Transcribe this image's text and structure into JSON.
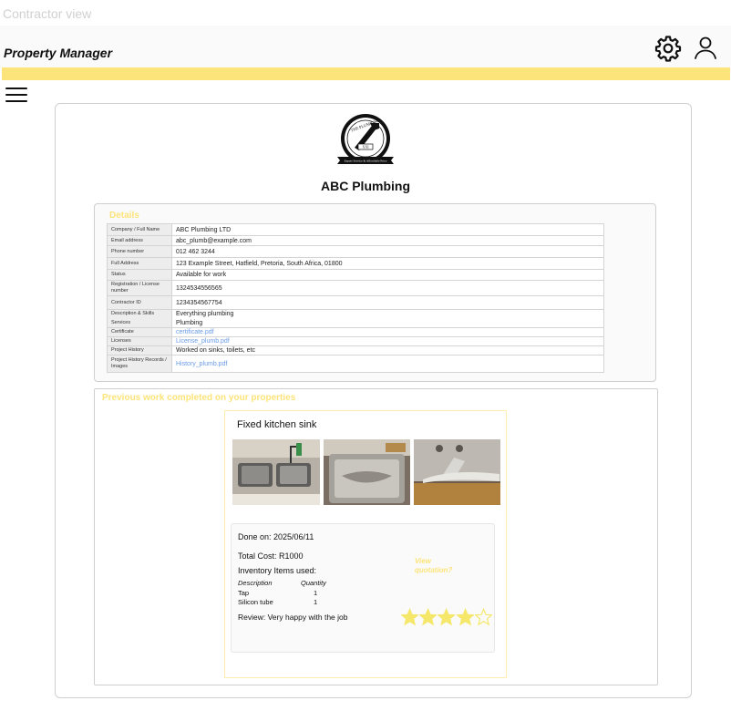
{
  "page_label": "Contractor view",
  "header": {
    "app_title": "Property Manager",
    "brand_color": "#fde47a",
    "icons": [
      "gear-icon",
      "user-icon"
    ]
  },
  "nav": {
    "menu_icon": "hamburger-icon"
  },
  "company": {
    "name": "ABC Plumbing",
    "logo": {
      "top_text": "THE PLUMBING",
      "badge_text": "XXI",
      "ribbon_text": "Expert Service & Affordable Price"
    }
  },
  "details": {
    "title": "Details",
    "rows": [
      {
        "label": "Company / Full Name",
        "value": "ABC Plumbing LTD"
      },
      {
        "label": "Email address",
        "value": "abc_plumb@example.com"
      },
      {
        "label": "Phone number",
        "value": "012 462 3244"
      },
      {
        "label": "Full Address",
        "value": "123 Example Street, Hatfield, Pretoria, South Africa, 01800"
      },
      {
        "label": "Status",
        "value": "Available for work"
      },
      {
        "label": "Registration / License number",
        "value": "1324534556565"
      },
      {
        "label": "Contractor ID",
        "value": "1234354567754"
      },
      {
        "label": "Description & Skills",
        "value": "Everything plumbing"
      },
      {
        "label": "Services",
        "value": "Plumbing"
      },
      {
        "label": "Certificate",
        "value": "certificate.pdf"
      },
      {
        "label": "Licenses",
        "value": "License_plumb.pdf"
      },
      {
        "label": "Project History",
        "value": "Worked on sinks, toilets, etc"
      },
      {
        "label": "Project History Records / Images",
        "value": "History_plumb.pdf"
      }
    ]
  },
  "previous_work": {
    "title": "Previous work completed on your properties",
    "job": {
      "title": "Fixed kitchen sink",
      "done_on": "Done on: 2025/06/11",
      "total_cost": "Total Cost: R1000",
      "inventory_label": "Inventory Items used:",
      "inventory_headers": {
        "description": "Description",
        "quantity": "Quantity"
      },
      "inventory": [
        {
          "description": "Tap",
          "quantity": "1"
        },
        {
          "description": "Silicon tube",
          "quantity": "1"
        }
      ],
      "view_quotation": "View quotation?",
      "review": "Review: Very happy with the job",
      "rating": 4,
      "rating_max": 5,
      "star_color": "#f5e76a"
    }
  }
}
